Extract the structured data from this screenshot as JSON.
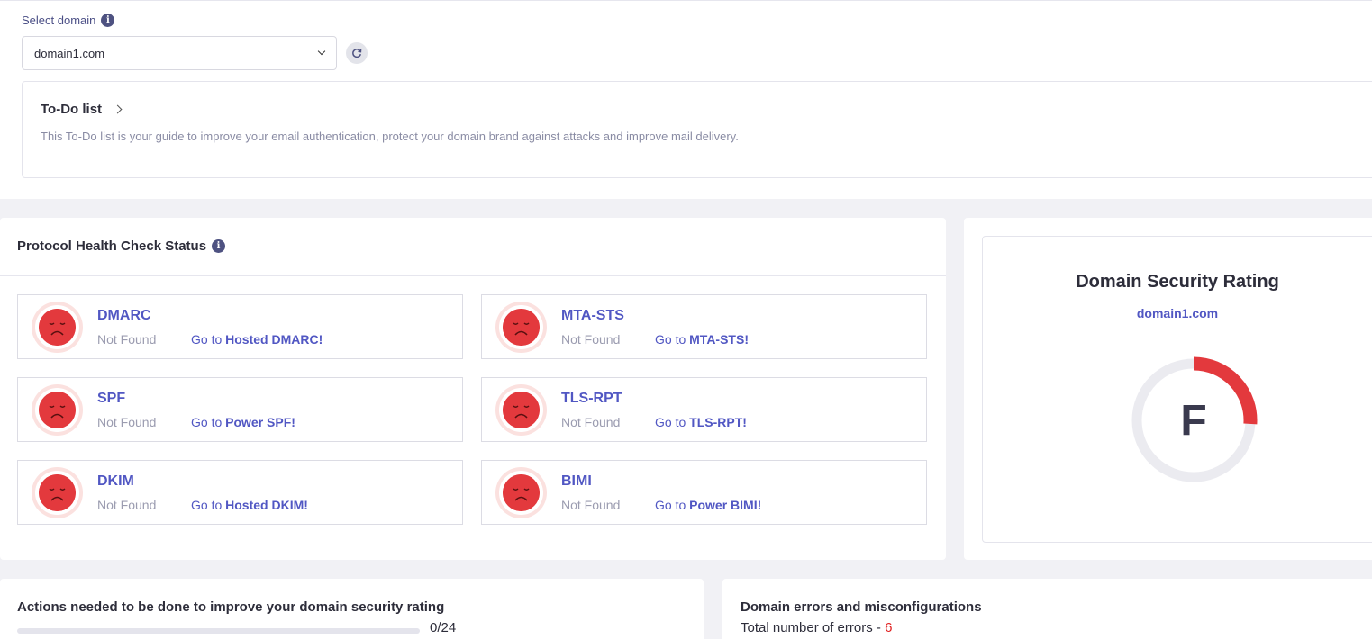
{
  "domain_selector": {
    "label": "Select domain",
    "selected": "domain1.com"
  },
  "todo": {
    "title": "To-Do list",
    "description": "This To-Do list is your guide to improve your email authentication, protect your domain brand against attacks and improve mail delivery."
  },
  "health": {
    "title": "Protocol Health Check Status",
    "protocols": [
      {
        "name": "DMARC",
        "status": "Not Found",
        "link_prefix": "Go to",
        "link_target": "Hosted DMARC!"
      },
      {
        "name": "MTA-STS",
        "status": "Not Found",
        "link_prefix": "Go to",
        "link_target": "MTA-STS!"
      },
      {
        "name": "SPF",
        "status": "Not Found",
        "link_prefix": "Go to",
        "link_target": "Power SPF!"
      },
      {
        "name": "TLS-RPT",
        "status": "Not Found",
        "link_prefix": "Go to",
        "link_target": "TLS-RPT!"
      },
      {
        "name": "DKIM",
        "status": "Not Found",
        "link_prefix": "Go to",
        "link_target": "Hosted DKIM!"
      },
      {
        "name": "BIMI",
        "status": "Not Found",
        "link_prefix": "Go to",
        "link_target": "Power BIMI!"
      }
    ]
  },
  "rating": {
    "title": "Domain Security Rating",
    "domain": "domain1.com",
    "grade": "F",
    "fill_fraction": 0.26,
    "colors": {
      "arc": "#e3393d",
      "track": "#ebebf0"
    }
  },
  "actions": {
    "title": "Actions needed to be done to improve your domain security rating",
    "progress_text": "0/24",
    "done": 0,
    "total": 24
  },
  "errors": {
    "title": "Domain errors and misconfigurations",
    "count_label": "Total number of errors -",
    "count": "6"
  },
  "colors": {
    "accent": "#5157c3",
    "error": "#e3393d",
    "background": "#f1f1f5"
  }
}
